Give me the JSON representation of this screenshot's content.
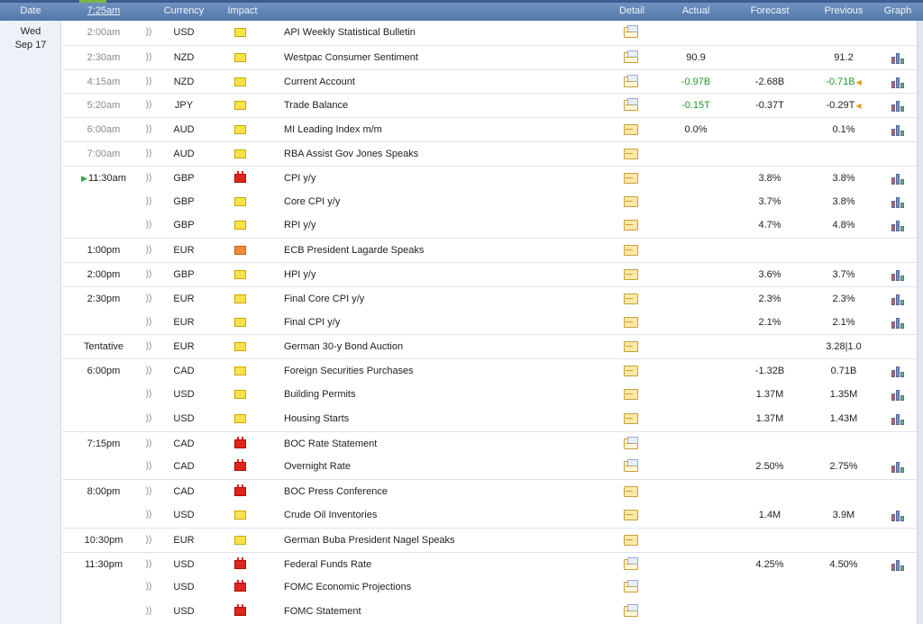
{
  "header": {
    "date": "Date",
    "time": "7:25am",
    "currency": "Currency",
    "impact": "Impact",
    "detail": "Detail",
    "actual": "Actual",
    "forecast": "Forecast",
    "previous": "Previous",
    "graph": "Graph"
  },
  "day": {
    "name": "Wed",
    "date": "Sep 17"
  },
  "colors": {
    "header_bg": "#5478aa",
    "actual_positive": "#1f9a2a",
    "low_impact": "#f7e24a",
    "medium_impact": "#ef8a3a",
    "high_impact": "#e0231c"
  },
  "rows": [
    {
      "time": "2:00am",
      "currency": "USD",
      "impact": "low",
      "event": "API Weekly Statistical Bulletin",
      "actual": "",
      "forecast": "",
      "previous": "",
      "graph": false,
      "detail": "open"
    },
    {
      "time": "2:30am",
      "currency": "NZD",
      "impact": "low",
      "event": "Westpac Consumer Sentiment",
      "actual": "90.9",
      "forecast": "",
      "previous": "91.2",
      "graph": true,
      "detail": "open"
    },
    {
      "time": "4:15am",
      "currency": "NZD",
      "impact": "low",
      "event": "Current Account",
      "actual": "-0.97B",
      "actual_color": "green",
      "forecast": "-2.68B",
      "previous": "-0.71B",
      "previous_color": "green",
      "previous_revised": true,
      "graph": true,
      "detail": "open"
    },
    {
      "time": "5:20am",
      "currency": "JPY",
      "impact": "low",
      "event": "Trade Balance",
      "actual": "-0.15T",
      "actual_color": "green",
      "forecast": "-0.37T",
      "previous": "-0.29T",
      "previous_revised": true,
      "graph": true,
      "detail": "open"
    },
    {
      "time": "6:00am",
      "currency": "AUD",
      "impact": "low",
      "event": "MI Leading Index m/m",
      "actual": "0.0%",
      "forecast": "",
      "previous": "0.1%",
      "graph": true,
      "detail": "folder"
    },
    {
      "time": "7:00am",
      "currency": "AUD",
      "impact": "low",
      "event": "RBA Assist Gov Jones Speaks",
      "actual": "",
      "forecast": "",
      "previous": "",
      "graph": false,
      "detail": "folder"
    },
    {
      "time": "11:30am",
      "current": true,
      "currency": "GBP",
      "impact": "high",
      "event": "CPI y/y",
      "actual": "",
      "forecast": "3.8%",
      "previous": "3.8%",
      "graph": true,
      "detail": "folder"
    },
    {
      "time": "",
      "currency": "GBP",
      "impact": "low",
      "event": "Core CPI y/y",
      "actual": "",
      "forecast": "3.7%",
      "previous": "3.8%",
      "graph": true,
      "detail": "folder"
    },
    {
      "time": "",
      "currency": "GBP",
      "impact": "low",
      "event": "RPI y/y",
      "actual": "",
      "forecast": "4.7%",
      "previous": "4.8%",
      "graph": true,
      "detail": "folder"
    },
    {
      "time": "1:00pm",
      "currency": "EUR",
      "impact": "med",
      "event": "ECB President Lagarde Speaks",
      "actual": "",
      "forecast": "",
      "previous": "",
      "graph": false,
      "detail": "folder"
    },
    {
      "time": "2:00pm",
      "currency": "GBP",
      "impact": "low",
      "event": "HPI y/y",
      "actual": "",
      "forecast": "3.6%",
      "previous": "3.7%",
      "graph": true,
      "detail": "folder"
    },
    {
      "time": "2:30pm",
      "currency": "EUR",
      "impact": "low",
      "event": "Final Core CPI y/y",
      "actual": "",
      "forecast": "2.3%",
      "previous": "2.3%",
      "graph": true,
      "detail": "folder"
    },
    {
      "time": "",
      "currency": "EUR",
      "impact": "low",
      "event": "Final CPI y/y",
      "actual": "",
      "forecast": "2.1%",
      "previous": "2.1%",
      "graph": true,
      "detail": "folder"
    },
    {
      "time": "Tentative",
      "currency": "EUR",
      "impact": "low",
      "event": "German 30-y Bond Auction",
      "actual": "",
      "forecast": "",
      "previous": "3.28|1.0",
      "graph": false,
      "detail": "folder"
    },
    {
      "time": "6:00pm",
      "currency": "CAD",
      "impact": "low",
      "event": "Foreign Securities Purchases",
      "actual": "",
      "forecast": "-1.32B",
      "previous": "0.71B",
      "graph": true,
      "detail": "folder"
    },
    {
      "time": "",
      "currency": "USD",
      "impact": "low",
      "event": "Building Permits",
      "actual": "",
      "forecast": "1.37M",
      "previous": "1.35M",
      "graph": true,
      "detail": "folder"
    },
    {
      "time": "",
      "currency": "USD",
      "impact": "low",
      "event": "Housing Starts",
      "actual": "",
      "forecast": "1.37M",
      "previous": "1.43M",
      "graph": true,
      "detail": "folder"
    },
    {
      "time": "7:15pm",
      "currency": "CAD",
      "impact": "high",
      "event": "BOC Rate Statement",
      "actual": "",
      "forecast": "",
      "previous": "",
      "graph": false,
      "detail": "open"
    },
    {
      "time": "",
      "currency": "CAD",
      "impact": "high",
      "event": "Overnight Rate",
      "actual": "",
      "forecast": "2.50%",
      "previous": "2.75%",
      "graph": true,
      "detail": "open"
    },
    {
      "time": "8:00pm",
      "currency": "CAD",
      "impact": "high",
      "event": "BOC Press Conference",
      "actual": "",
      "forecast": "",
      "previous": "",
      "graph": false,
      "detail": "folder"
    },
    {
      "time": "",
      "currency": "USD",
      "impact": "low",
      "event": "Crude Oil Inventories",
      "actual": "",
      "forecast": "1.4M",
      "previous": "3.9M",
      "graph": true,
      "detail": "folder"
    },
    {
      "time": "10:30pm",
      "currency": "EUR",
      "impact": "low",
      "event": "German Buba President Nagel Speaks",
      "actual": "",
      "forecast": "",
      "previous": "",
      "graph": false,
      "detail": "folder"
    },
    {
      "time": "11:30pm",
      "currency": "USD",
      "impact": "high",
      "event": "Federal Funds Rate",
      "actual": "",
      "forecast": "4.25%",
      "previous": "4.50%",
      "graph": true,
      "detail": "open"
    },
    {
      "time": "",
      "currency": "USD",
      "impact": "high",
      "event": "FOMC Economic Projections",
      "actual": "",
      "forecast": "",
      "previous": "",
      "graph": false,
      "detail": "open"
    },
    {
      "time": "",
      "currency": "USD",
      "impact": "high",
      "event": "FOMC Statement",
      "actual": "",
      "forecast": "",
      "previous": "",
      "graph": false,
      "detail": "open"
    }
  ]
}
